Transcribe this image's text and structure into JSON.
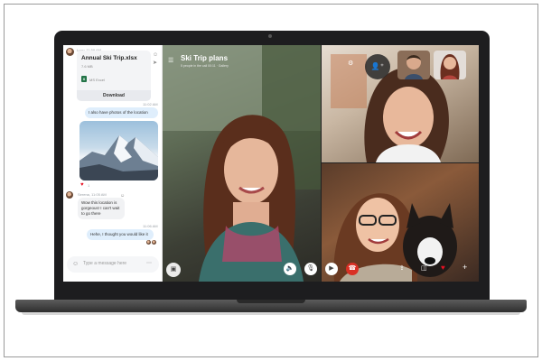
{
  "chat": {
    "sender_top": "Lucy, 11:59 AM",
    "file": {
      "name": "Annual Ski Trip.xlsx",
      "size": "7.6 MB",
      "type": "MS Excel",
      "download_label": "Download"
    },
    "msg1_time": "11:02 AM",
    "msg1": "I also have photos of the location",
    "reaction_count": "1",
    "incoming_sender": "Serena, 11:05 AM",
    "incoming_msg": "Wow this location is gorgeous! I can't wait to go there",
    "msg2_time": "11:06 AM",
    "msg2": "Hehe, I thought you would like it",
    "composer_placeholder": "Type a message here"
  },
  "call": {
    "title": "Ski Trip plans",
    "subtitle": "5 people in the call 00:11 · Gallery"
  },
  "icons": {
    "menu": "hamburger-icon",
    "chat": "chat-icon",
    "volume": "speaker-icon",
    "mic": "mic-icon",
    "video": "video-icon",
    "end": "end-call-icon",
    "share": "share-screen-icon",
    "heart": "heart-icon",
    "add": "add-icon",
    "settings": "gear-icon",
    "add_person": "add-person-icon"
  },
  "colors": {
    "accent": "#0078d4",
    "end_call": "#d93025",
    "heart": "#e81123"
  }
}
